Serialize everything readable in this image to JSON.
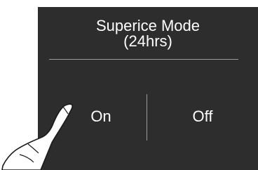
{
  "dialog": {
    "title_line1": "Superice Mode",
    "title_line2": "(24hrs)",
    "options": [
      {
        "label": "On"
      },
      {
        "label": "Off"
      }
    ]
  },
  "colors": {
    "panel_bg": "#2d2d2d",
    "text": "#ffffff",
    "divider": "#9a9a9a",
    "hand_fill": "#ffffff",
    "hand_stroke": "#1a1a1a"
  },
  "icons": {
    "pointer": "hand-pointer-icon"
  }
}
